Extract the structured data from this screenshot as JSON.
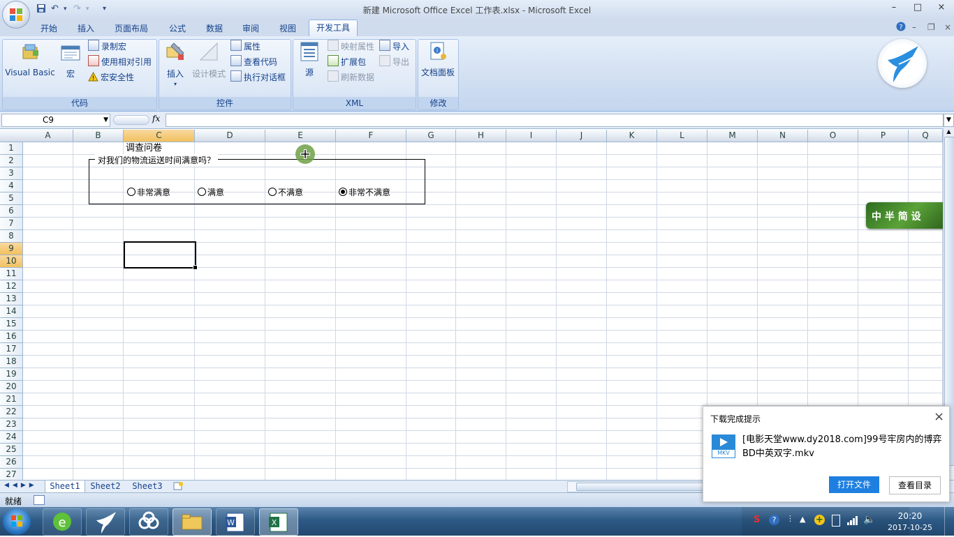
{
  "window": {
    "title": "新建 Microsoft Office Excel 工作表.xlsx - Microsoft Excel",
    "controls": [
      "–",
      "□",
      "×"
    ]
  },
  "tabs": [
    "开始",
    "插入",
    "页面布局",
    "公式",
    "数据",
    "审阅",
    "视图",
    "开发工具"
  ],
  "active_tab": "开发工具",
  "ribbon": {
    "code": {
      "label": "代码",
      "visual_basic": "Visual Basic",
      "macro": "宏",
      "record_macro": "录制宏",
      "relative_ref": "使用相对引用",
      "macro_security": "宏安全性"
    },
    "controls": {
      "label": "控件",
      "insert": "插入",
      "design_mode": "设计模式",
      "properties": "属性",
      "view_code": "查看代码",
      "run_dialog": "执行对话框"
    },
    "xml": {
      "label": "XML",
      "source": "源",
      "map_props": "映射属性",
      "expansion": "扩展包",
      "refresh": "刷新数据",
      "import": "导入",
      "export": "导出"
    },
    "modify": {
      "label": "修改",
      "doc_panel": "文档面板"
    }
  },
  "formula_bar": {
    "name_box": "C9",
    "fx": "fx",
    "formula": ""
  },
  "columns": [
    "A",
    "B",
    "C",
    "D",
    "E",
    "F",
    "G",
    "H",
    "I",
    "J",
    "K",
    "L",
    "M",
    "N",
    "O",
    "P",
    "Q"
  ],
  "rows": [
    "1",
    "2",
    "3",
    "4",
    "5",
    "6",
    "7",
    "8",
    "9",
    "10",
    "11",
    "12",
    "13",
    "14",
    "15",
    "16",
    "17",
    "18",
    "19",
    "20",
    "21",
    "22",
    "23",
    "24",
    "25",
    "26",
    "27"
  ],
  "sheet": {
    "c1_text": "调查问卷",
    "group_box_label": "对我们的物流运送时间满意吗？",
    "options": [
      "非常满意",
      "满意",
      "不满意",
      "非常不满意"
    ],
    "selected_option": "非常不满意"
  },
  "sheet_tabs": [
    "Sheet1",
    "Sheet2",
    "Sheet3"
  ],
  "status": {
    "ready": "就绪"
  },
  "side_logo_text": "中 半 简 设",
  "popup": {
    "title": "下载完成提示",
    "file_type": "MKV",
    "filename": "[电影天堂www.dy2018.com]99号牢房内的博弈BD中英双字.mkv",
    "open_file": "打开文件",
    "view_dir": "查看目录"
  },
  "clock": {
    "time": "20:20",
    "date": "2017-10-25"
  },
  "colors": {
    "accent": "#15428b",
    "popup_button": "#1e7fe0",
    "selected_cell_border": "#000000"
  }
}
